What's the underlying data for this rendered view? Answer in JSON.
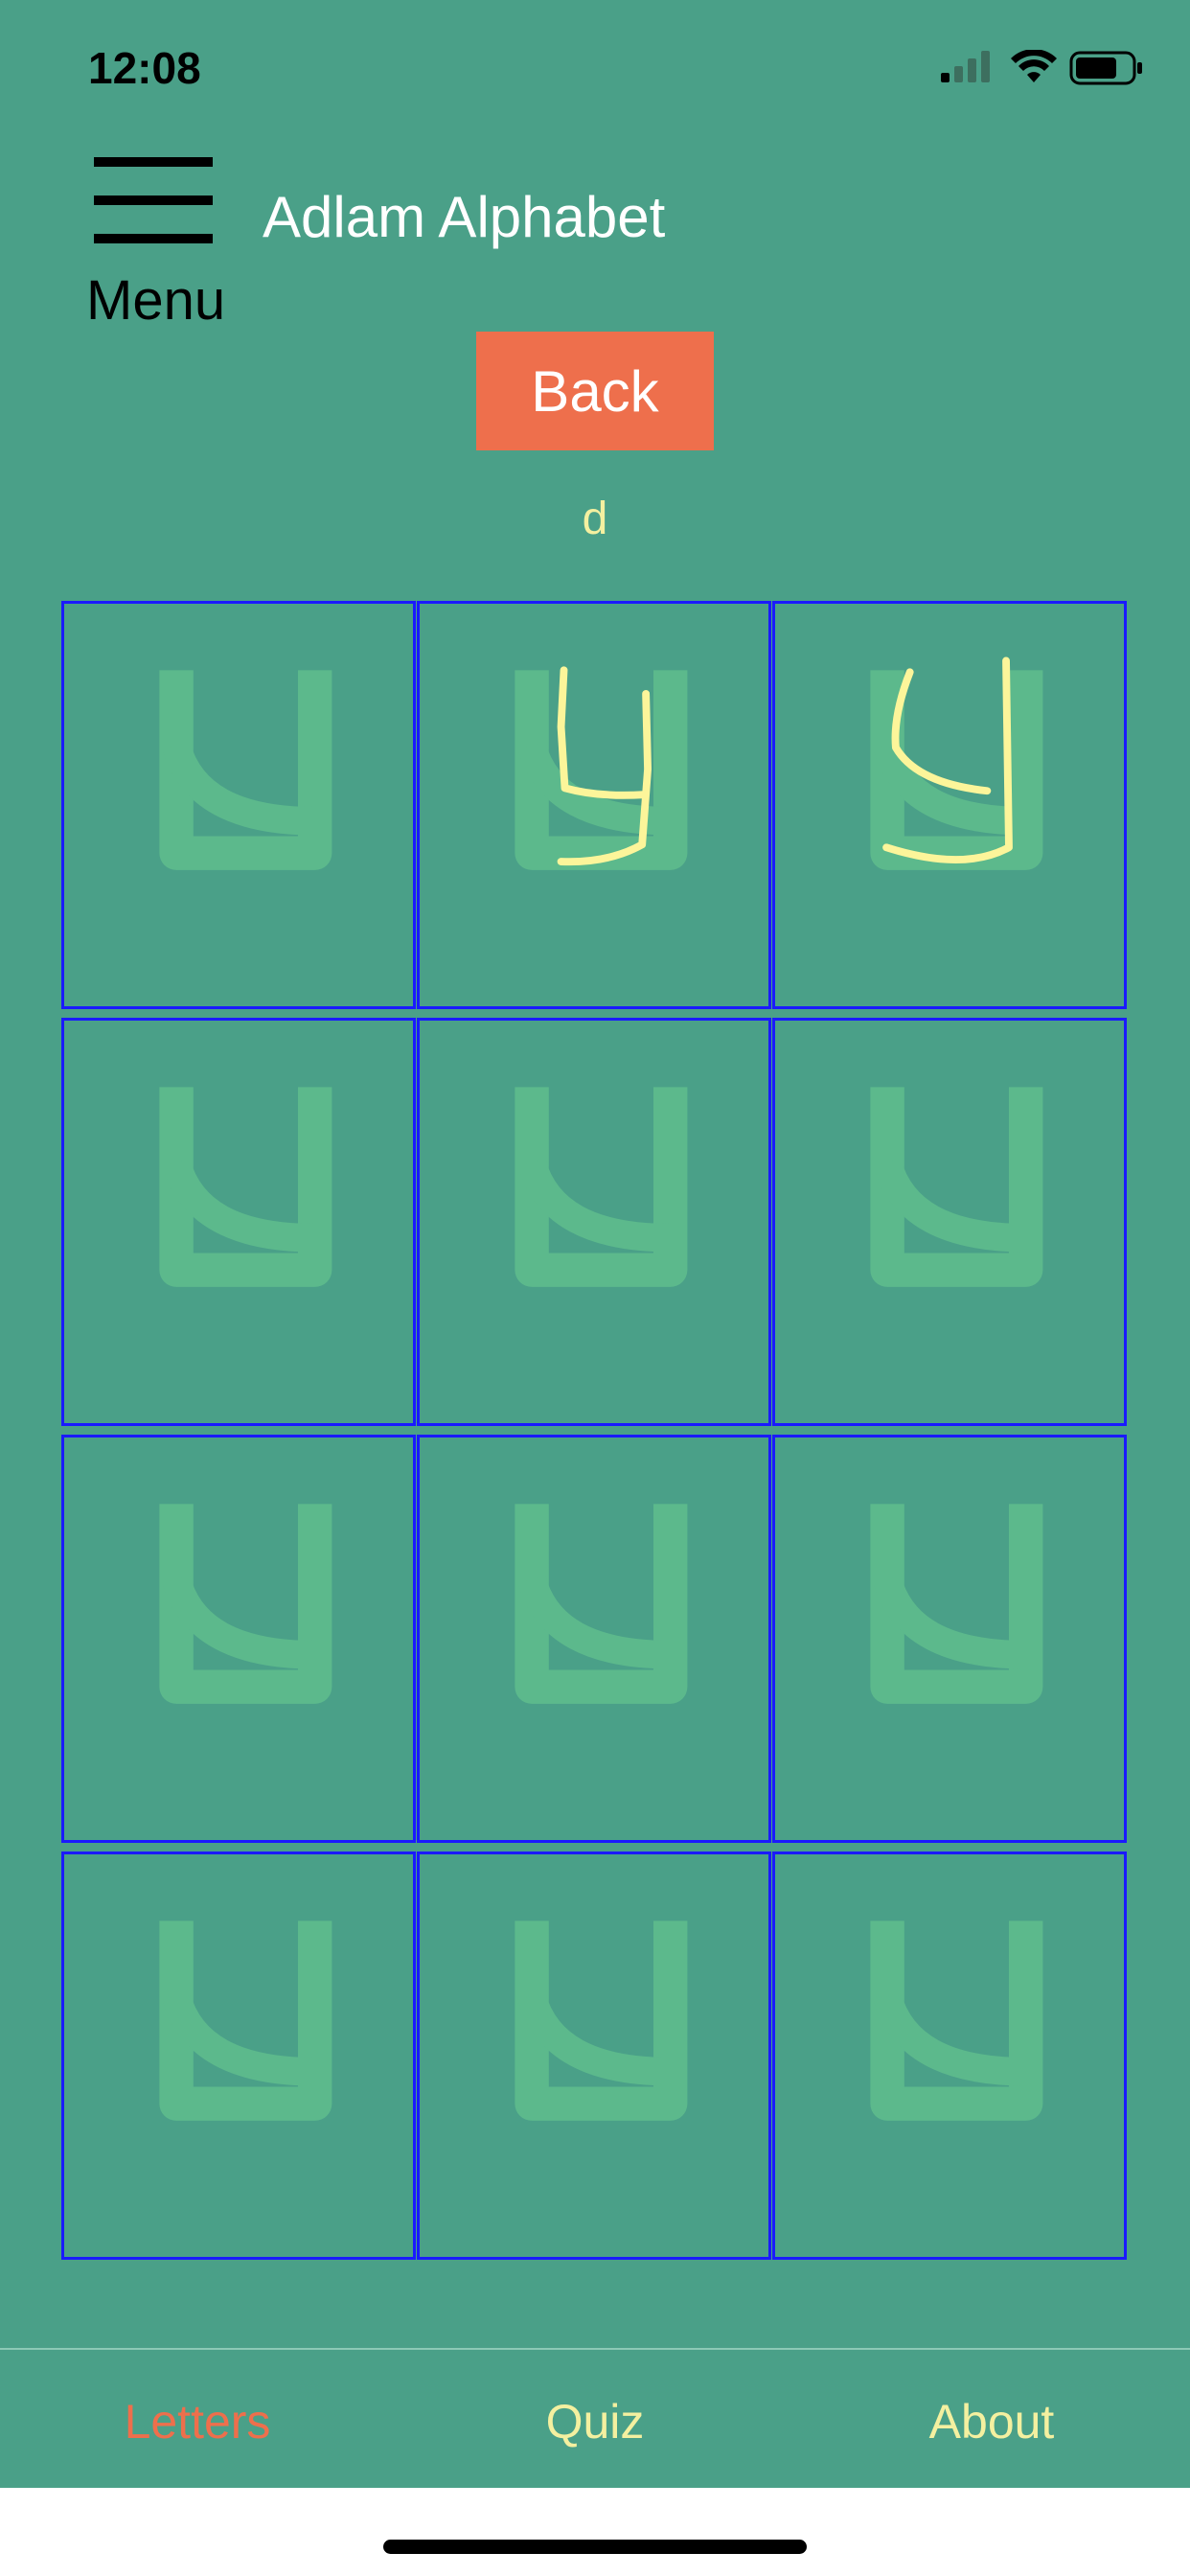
{
  "status_bar": {
    "time": "12:08"
  },
  "header": {
    "menu_label": "Menu",
    "title": "Adlam Alphabet"
  },
  "back_button": {
    "label": "Back"
  },
  "current_letter": {
    "label": "d"
  },
  "practice_grid": {
    "rows": 4,
    "columns": 3,
    "guide_glyph": "adlam-letter-da-trace-guide",
    "cells_with_strokes": [
      1,
      2
    ]
  },
  "tabs": [
    {
      "label": "Letters",
      "active": true
    },
    {
      "label": "Quiz",
      "active": false
    },
    {
      "label": "About",
      "active": false
    }
  ],
  "colors": {
    "background": "#4aa088",
    "accent": "#ee6f4c",
    "text_light": "#f4f0a0",
    "grid_border": "#1a1aff",
    "guide_glyph": "#5cb98c",
    "stroke": "#fcf59a"
  }
}
